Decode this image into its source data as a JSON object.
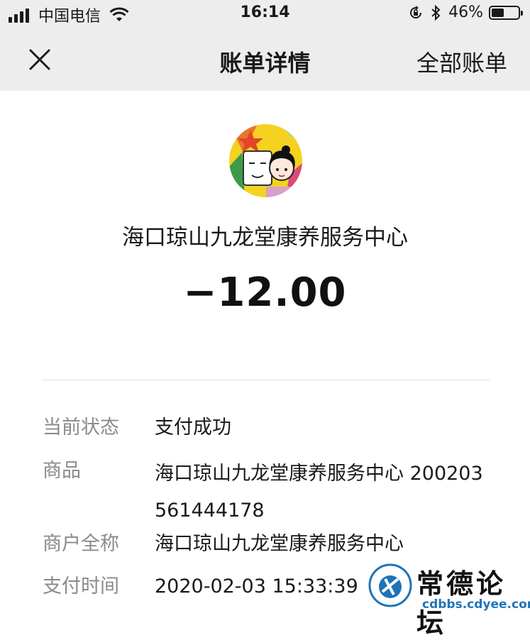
{
  "status_bar": {
    "carrier": "中国电信",
    "time": "16:14",
    "battery_percent": "46%",
    "battery_level": 0.46,
    "icons": [
      "signal-icon",
      "wifi-icon",
      "rotation-lock-icon",
      "bluetooth-icon",
      "battery-icon"
    ]
  },
  "nav": {
    "title": "账单详情",
    "right_link": "全部账单",
    "close_icon": "close-icon"
  },
  "merchant": {
    "name": "海口琼山九龙堂康养服务中心",
    "amount": "−12.00"
  },
  "details": [
    {
      "label": "当前状态",
      "value": "支付成功"
    },
    {
      "label": "商品",
      "value": "海口琼山九龙堂康养服务中心 200203561444178"
    },
    {
      "label": "商户全称",
      "value": "海口琼山九龙堂康养服务中心"
    },
    {
      "label": "支付时间",
      "value": "2020-02-03 15:33:39"
    }
  ],
  "watermark": {
    "title": "常德论坛",
    "url": "cdbbs.cdyee.com"
  },
  "colors": {
    "nav_background": "#ededed",
    "label_gray": "#8a8a8a",
    "text": "#1a1a1a",
    "watermark_blue": "#1f73b8"
  }
}
